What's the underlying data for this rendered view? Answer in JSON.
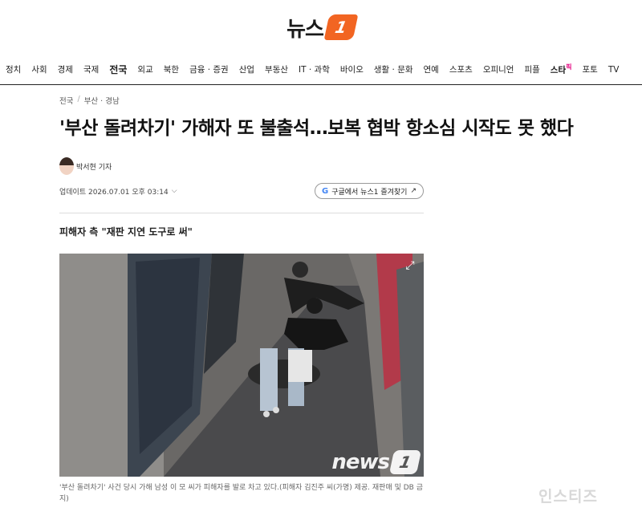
{
  "header": {
    "logo_text": "뉴스",
    "logo_mark": "1"
  },
  "nav": [
    {
      "label": "정치"
    },
    {
      "label": "사회"
    },
    {
      "label": "경제"
    },
    {
      "label": "국제"
    },
    {
      "label": "전국",
      "active": true
    },
    {
      "label": "외교"
    },
    {
      "label": "북한"
    },
    {
      "label": "금융 · 증권"
    },
    {
      "label": "산업"
    },
    {
      "label": "부동산"
    },
    {
      "label": "IT · 과학"
    },
    {
      "label": "바이오"
    },
    {
      "label": "생활 · 문화"
    },
    {
      "label": "연예"
    },
    {
      "label": "스포츠"
    },
    {
      "label": "오피니언"
    },
    {
      "label": "피플"
    },
    {
      "label": "스타",
      "suffix": "픽",
      "star": true
    },
    {
      "label": "포토"
    },
    {
      "label": "TV"
    }
  ],
  "article": {
    "breadcrumb": [
      "전국",
      "부산 · 경남"
    ],
    "title": "'부산 돌려차기' 가해자 또 불출석…보복 협박 항소심 시작도 못 했다",
    "reporter": "박서현 기자",
    "updated": "업데이트 2026.07.01 오후 03:14",
    "google_button": "구글에서 뉴스1 즐겨찾기",
    "subhead": "피해자 측 \"재판 지연 도구로 써\"",
    "photo_watermark_text": "news",
    "photo_watermark_mark": "1",
    "caption": "'부산 돌려차기' 사건 당시 가해 남성 이 모 씨가 피해자를 발로 차고 있다.(피해자 김진주 씨(가명) 제공. 재판매 및 DB 금지)"
  },
  "site_watermark": "인스티즈",
  "icons": {
    "expand": "expand-icon",
    "chevron": "chevron-down-icon",
    "external": "external-link-icon",
    "google": "google-icon"
  },
  "colors": {
    "brand": "#f26522",
    "star": "#e4007f"
  }
}
